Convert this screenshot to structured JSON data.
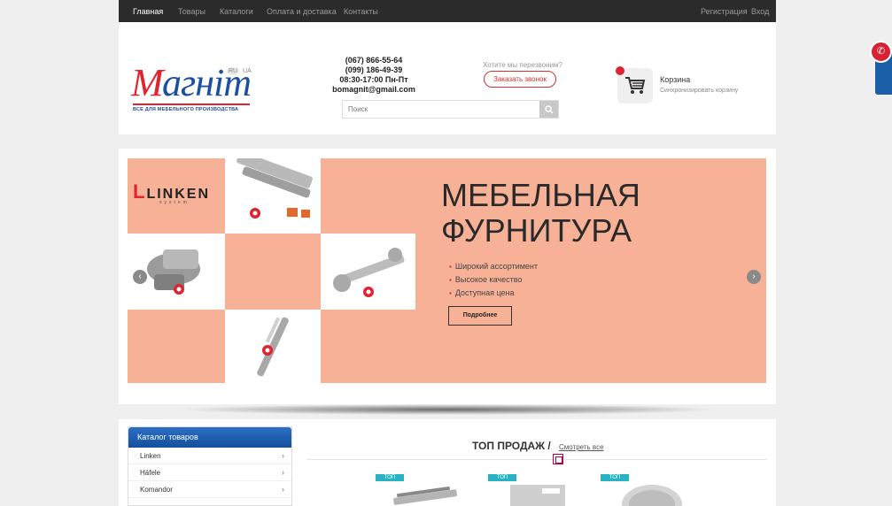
{
  "topnav": {
    "items": [
      "Главная",
      "Товары",
      "Каталоги",
      "Оплата и доставка",
      "Контакты"
    ],
    "register": "Регистрация",
    "login": "Вход"
  },
  "header": {
    "logo_text": "Магніт",
    "logo_sub": "ВСЕ ДЛЯ МЕБЕЛЬНОГО ПРОИЗВОДСТВА",
    "lang": [
      "RU",
      "UA"
    ],
    "phones": [
      "(067) 866-55-64",
      "(099) 186-49-39"
    ],
    "hours": "08:30-17:00 Пн-Пт",
    "email": "bomagnit@gmail.com",
    "callback_question": "Хотите мы перезвоним?",
    "callback_button": "Заказать звонок",
    "search_placeholder": "Поиск",
    "cart_title": "Корзина",
    "cart_sub": "Синхронизировать корзину"
  },
  "banner": {
    "brand": "LINKEN",
    "brand_sub": "system",
    "headline_1": "МЕБЕЛЬНАЯ",
    "headline_2": "ФУРНИТУРА",
    "bullets": [
      "Широкий ассортимент",
      "Высокое качество",
      "Доступная цена"
    ],
    "button": "Подробнее"
  },
  "catalog": {
    "title": "Каталог товаров",
    "items": [
      "Linken",
      "Häfele",
      "Komandor"
    ]
  },
  "top_sales": {
    "title": "ТОП ПРОДАЖ /",
    "link": "Смотреть все",
    "badges": [
      "ТОП",
      "ТОП",
      "ТОП"
    ]
  },
  "colors": {
    "brand_blue": "#1d4fa0",
    "brand_red": "#e0232e",
    "banner_bg": "#f6b196",
    "badge_teal": "#27b3c1"
  }
}
